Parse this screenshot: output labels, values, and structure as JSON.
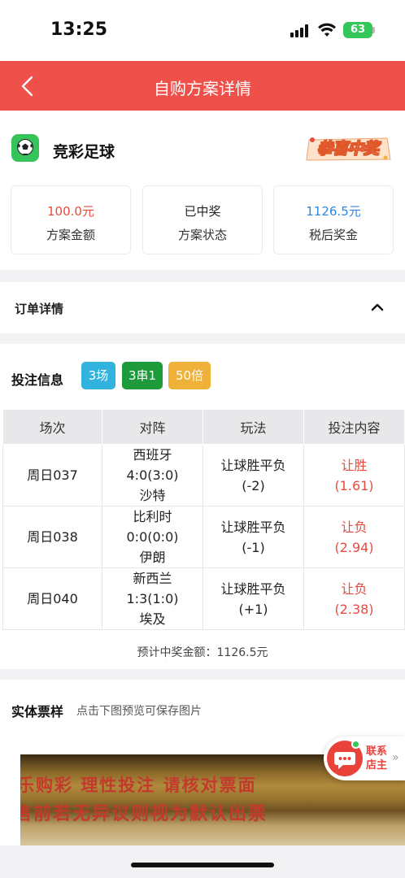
{
  "status_bar": {
    "time": "13:25",
    "battery": "63"
  },
  "nav": {
    "title": "自购方案详情"
  },
  "lottery": {
    "name": "竞彩足球",
    "badge": "恭喜中奖"
  },
  "stats": [
    {
      "value": "100.0元",
      "label": "方案金额",
      "color": "#e94a3f"
    },
    {
      "value": "已中奖",
      "label": "方案状态",
      "color": "#222222"
    },
    {
      "value": "1126.5元",
      "label": "税后奖金",
      "color": "#2f86e0"
    }
  ],
  "order": {
    "label": "订单详情"
  },
  "bet": {
    "title": "投注信息",
    "tags": [
      {
        "text": "3场",
        "color": "#32b3dd"
      },
      {
        "text": "3串1",
        "color": "#1f9a3a"
      },
      {
        "text": "50倍",
        "color": "#f0b13a"
      }
    ],
    "table": {
      "headers": [
        "场次",
        "对阵",
        "玩法",
        "投注内容"
      ],
      "rows": [
        {
          "match": "周日037",
          "home": "西班牙",
          "score": "4:0(3:0)",
          "away": "沙特",
          "play": "让球胜平负",
          "handicap": "(-2)",
          "pick": "让胜",
          "odds": "(1.61)"
        },
        {
          "match": "周日038",
          "home": "比利时",
          "score": "0:0(0:0)",
          "away": "伊朗",
          "play": "让球胜平负",
          "handicap": "(-1)",
          "pick": "让负",
          "odds": "(2.94)"
        },
        {
          "match": "周日040",
          "home": "新西兰",
          "score": "1:3(1:0)",
          "away": "埃及",
          "play": "让球胜平负",
          "handicap": "(+1)",
          "pick": "让负",
          "odds": "(2.38)"
        }
      ]
    },
    "expected": "预计中奖金额：1126.5元"
  },
  "ticket": {
    "title": "实体票样",
    "hint": "点击下图预览可保存图片",
    "line1": "乐购彩  理性投注  请核对票面",
    "line2": "售前若无异议则视为默认出票"
  },
  "contact": {
    "label": "联系店主"
  }
}
